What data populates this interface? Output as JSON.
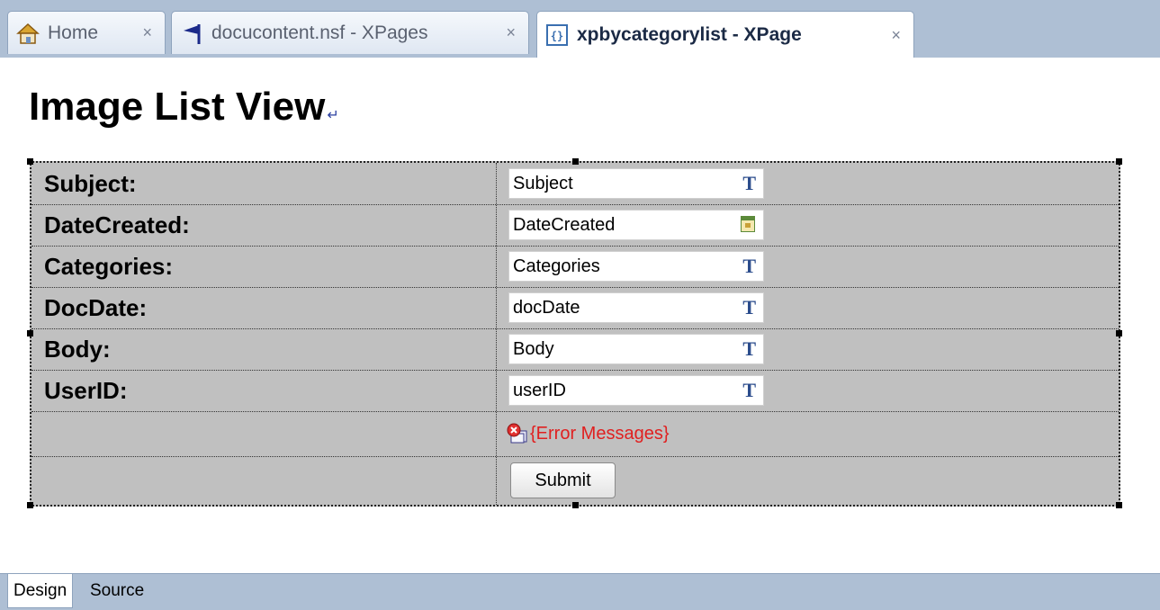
{
  "tabs": [
    {
      "label": "Home",
      "icon": "home-icon",
      "close": "×"
    },
    {
      "label": "docucontent.nsf - XPages",
      "icon": "flag-icon",
      "close": "×"
    },
    {
      "label": "xpbycategorylist - XPage",
      "icon": "xpage-icon",
      "close": "×",
      "active": true
    }
  ],
  "page": {
    "title": "Image List View",
    "pilcrow": "↵"
  },
  "form": {
    "rows": [
      {
        "label": "Subject:",
        "value": "Subject",
        "type_icon": "T"
      },
      {
        "label": "DateCreated:",
        "value": "DateCreated",
        "type_icon": "calendar-icon"
      },
      {
        "label": "Categories:",
        "value": "Categories",
        "type_icon": "T"
      },
      {
        "label": "DocDate:",
        "value": "docDate",
        "type_icon": "T"
      },
      {
        "label": "Body:",
        "value": "Body",
        "type_icon": "T"
      },
      {
        "label": "UserID:",
        "value": "userID",
        "type_icon": "T"
      }
    ],
    "error_messages": "{Error Messages}",
    "submit_label": "Submit"
  },
  "bottom_tabs": [
    {
      "label": "Design",
      "active": true
    },
    {
      "label": "Source"
    }
  ],
  "colors": {
    "tabbar": "#aebfd4",
    "table_bg": "#c0c0c0",
    "error_red": "#e02020",
    "type_icon_blue": "#2b4c8c"
  }
}
